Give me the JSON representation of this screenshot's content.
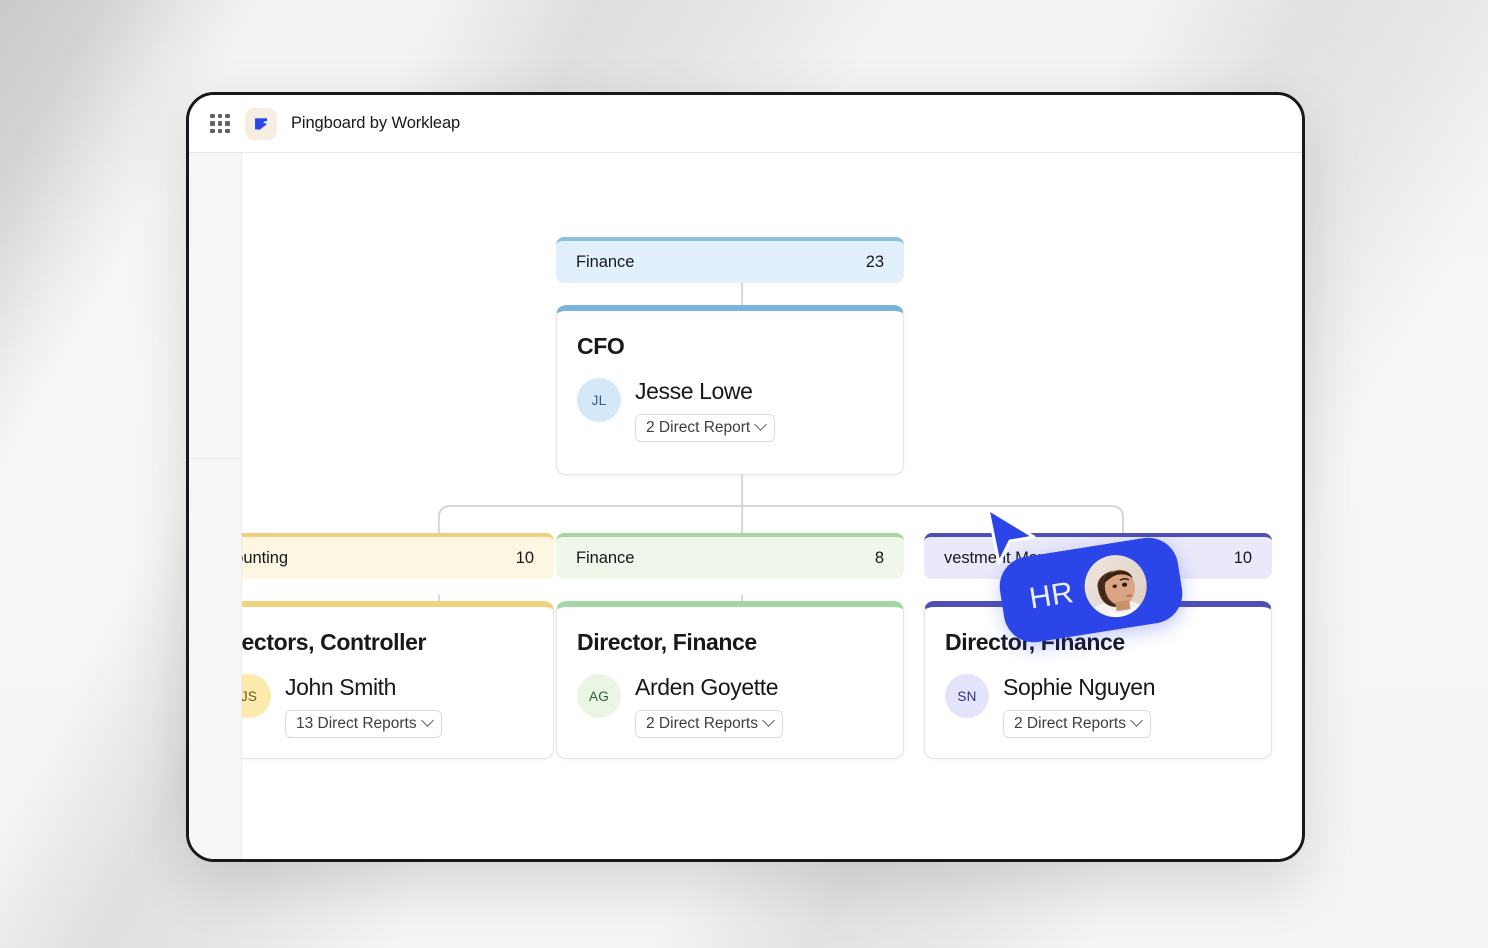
{
  "window": {
    "topbar": {
      "grid_icon": "apps-grid-icon",
      "logo_icon": "pingboard-logo-icon",
      "title": "Pingboard by Workleap"
    }
  },
  "org_chart": {
    "root_department": {
      "label": "Finance",
      "count": "23",
      "bg": "#e2f0fb",
      "accent": "#8cbfe0"
    },
    "root_person": {
      "role": "CFO",
      "name": "Jesse Lowe",
      "initials": "JL",
      "reports_label": "2 Direct Report",
      "accent": "#7cb3d9",
      "avatar_bg": "#d4e9f8",
      "avatar_fg": "#2c5f77"
    },
    "children": [
      {
        "department": {
          "label": "counting",
          "count": "10",
          "bg": "#fdf6e0",
          "accent": "#f0cf7f"
        },
        "role": "irectors, Controller",
        "name": "John Smith",
        "initials": "JS",
        "reports_label": "13 Direct Reports",
        "accent": "#f3d27f",
        "avatar_bg": "#fbecad",
        "avatar_fg": "#6b5a14"
      },
      {
        "department": {
          "label": "Finance",
          "count": "8",
          "bg": "#eef7e9",
          "accent": "#a9d69f"
        },
        "role": "Director, Finance",
        "name": "Arden Goyette",
        "initials": "AG",
        "reports_label": "2 Direct Reports",
        "accent": "#a5d6a7",
        "avatar_bg": "#eaf5e3",
        "avatar_fg": "#2f5c33"
      },
      {
        "department": {
          "label": "vestment Management",
          "count": "10",
          "bg": "#e9e9fa",
          "accent": "#4f4fb5"
        },
        "role": "Director, Finance",
        "name": "Sophie Nguyen",
        "initials": "SN",
        "reports_label": "2 Direct Reports",
        "accent": "#4f4fb5",
        "avatar_bg": "#e3e4fb",
        "avatar_fg": "#30307a"
      }
    ]
  },
  "collaborator": {
    "cursor_icon": "cursor-pointer-icon",
    "label": "HR",
    "avatar_icon": "collaborator-photo",
    "color": "#2b45e8"
  }
}
